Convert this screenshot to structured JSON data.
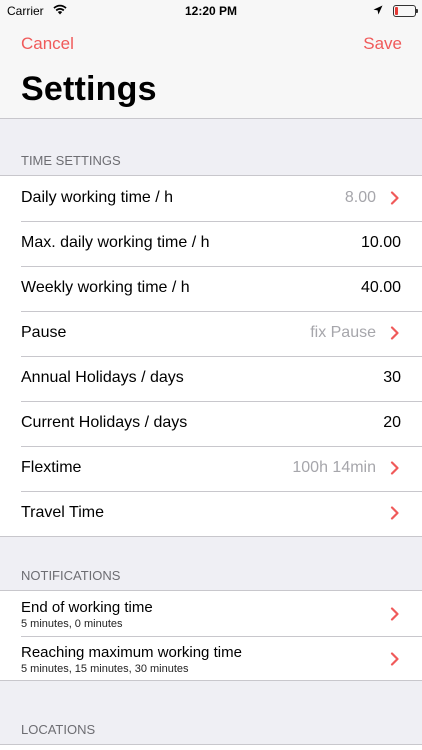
{
  "status_bar": {
    "carrier": "Carrier",
    "time": "12:20 PM",
    "battery_color": "#e53935"
  },
  "nav": {
    "cancel_label": "Cancel",
    "save_label": "Save",
    "title": "Settings",
    "accent_color": "#f05a5a"
  },
  "sections": {
    "time_settings": {
      "header": "TIME SETTINGS",
      "rows": [
        {
          "label": "Daily working time / h",
          "value": "8.00"
        },
        {
          "label": "Max. daily working time / h",
          "value": "10.00"
        },
        {
          "label": "Weekly working time / h",
          "value": "40.00"
        },
        {
          "label": "Pause",
          "value": "fix Pause"
        },
        {
          "label": "Annual Holidays / days",
          "value": "30"
        },
        {
          "label": "Current Holidays / days",
          "value": "20"
        },
        {
          "label": "Flextime",
          "value": "100h 14min"
        },
        {
          "label": "Travel Time",
          "value": ""
        }
      ]
    },
    "notifications": {
      "header": "NOTIFICATIONS",
      "rows": [
        {
          "label": "End of working time",
          "detail": "5 minutes, 0 minutes"
        },
        {
          "label": "Reaching maximum working time",
          "detail": "5 minutes, 15 minutes, 30 minutes"
        }
      ]
    },
    "locations": {
      "header": "LOCATIONS"
    }
  },
  "icons": {
    "wifi": "wifi-icon",
    "location": "location-arrow-icon",
    "battery": "battery-icon",
    "disclosure": "chevron-right-icon"
  }
}
